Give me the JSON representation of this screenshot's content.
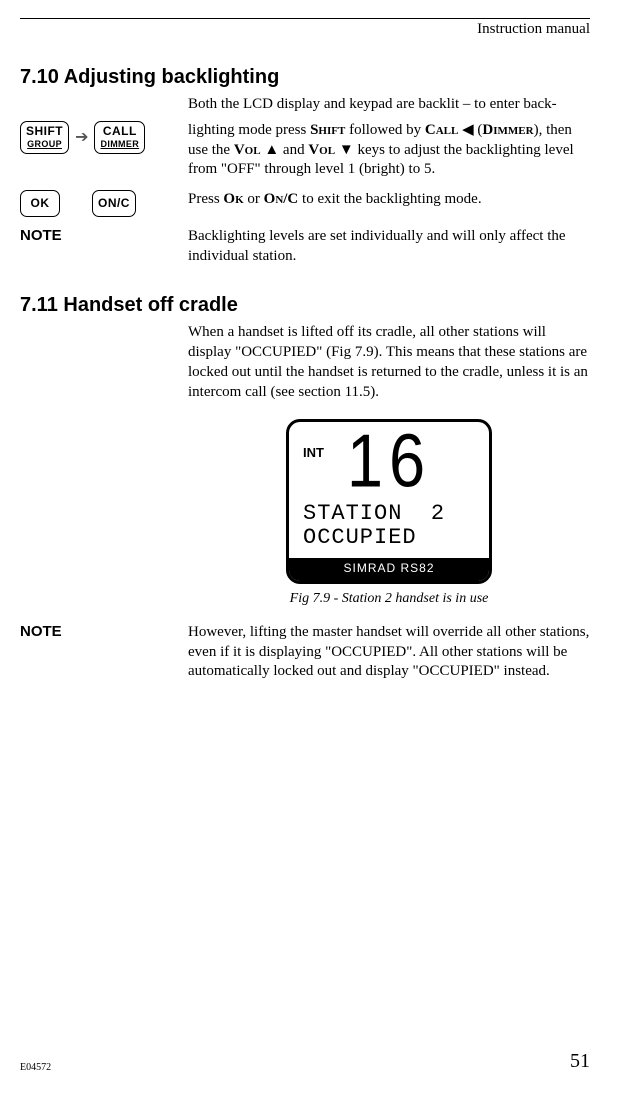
{
  "header": {
    "title": "Instruction manual"
  },
  "sections": {
    "s710": {
      "title": "7.10  Adjusting backlighting",
      "p1a": "Both the LCD display and keypad are backlit – to enter back-",
      "p1b_before": "lighting mode press ",
      "p1b_shift": "Shift",
      "p1b_mid1": " followed by ",
      "p1b_call": "Call",
      "p1b_arrow": " ◀ ",
      "p1b_dimmer_open": "(",
      "p1b_dimmer": "Dimmer",
      "p1b_dimmer_close": "), then use the ",
      "p1b_volup": "Vol",
      "p1b_up": " ▲ ",
      "p1b_and": "and ",
      "p1b_voldn": "Vol",
      "p1b_dn": " ▼ ",
      "p1b_tail": "keys to adjust the backlighting level from \"OFF\" through level 1 (bright) to 5.",
      "p2_before": "Press ",
      "p2_ok": "Ok",
      "p2_mid": " or ",
      "p2_onc": "On/C",
      "p2_after": " to exit the backlighting mode.",
      "note_label": "NOTE",
      "note_text": "Backlighting levels are set individually and will only affect the individual station."
    },
    "s711": {
      "title": "7.11  Handset off cradle",
      "p1": "When a handset is lifted off its cradle, all other stations will display \"OCCUPIED\" (Fig 7.9). This means that these stations are locked out until the handset is returned to the cradle, unless it is an intercom call (see section 11.5).",
      "fig": {
        "int": "INT",
        "big": "16",
        "line1": "STATION  2",
        "line2": "OCCUPIED",
        "brand": "SIMRAD RS82",
        "caption": "Fig 7.9 - Station 2 handset is in use"
      },
      "note_label": "NOTE",
      "note_text": "However, lifting the master handset will override all other stations, even if it is displaying \"OCCUPIED\". All other stations will be automatically locked out and display \"OCCUPIED\" instead."
    }
  },
  "keys": {
    "shift_top": "SHIFT",
    "shift_bottom": "GROUP",
    "call_top": "CALL",
    "call_bottom": "DIMMER",
    "ok": "OK",
    "onc": "ON/C"
  },
  "footer": {
    "docid": "E04572",
    "page": "51"
  }
}
